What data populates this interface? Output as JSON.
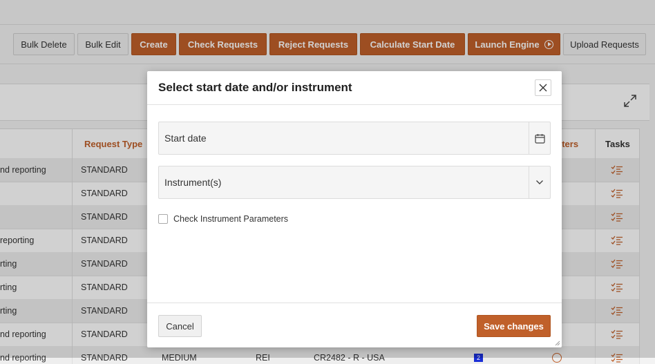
{
  "toolbar": {
    "bulk_delete": "Bulk Delete",
    "bulk_edit": "Bulk Edit",
    "create": "Create",
    "check_requests": "Check Requests",
    "reject_requests": "Reject Requests",
    "calculate_start_date": "Calculate Start Date",
    "launch_engine": "Launch Engine",
    "upload_requests": "Upload Requests"
  },
  "grid": {
    "headers": {
      "request_type": "Request Type",
      "parameters": "eters",
      "tasks": "Tasks"
    },
    "rows": [
      {
        "desc": "nd reporting",
        "type": "STANDARD"
      },
      {
        "desc": "",
        "type": "STANDARD"
      },
      {
        "desc": "",
        "type": "STANDARD"
      },
      {
        "desc": "reporting",
        "type": "STANDARD"
      },
      {
        "desc": "rting",
        "type": "STANDARD"
      },
      {
        "desc": "rting",
        "type": "STANDARD"
      },
      {
        "desc": "rting",
        "type": "STANDARD"
      },
      {
        "desc": "nd reporting",
        "type": "STANDARD"
      },
      {
        "desc": "nd reporting",
        "type": "STANDARD",
        "priority": "MEDIUM",
        "code": "REI",
        "ref": "CR2482 - R - USA",
        "badge": "2"
      }
    ]
  },
  "modal": {
    "title": "Select start date and/or instrument",
    "start_date_placeholder": "Start date",
    "instrument_placeholder": "Instrument(s)",
    "check_label": "Check Instrument Parameters",
    "cancel": "Cancel",
    "save": "Save changes"
  },
  "colors": {
    "accent": "#c0602a",
    "badge": "#1a2fd6"
  },
  "icons": [
    "play-circle-icon",
    "expand-icon",
    "task-list-icon",
    "circle-icon",
    "close-icon",
    "calendar-icon",
    "chevron-down-icon",
    "resize-grip-icon"
  ]
}
